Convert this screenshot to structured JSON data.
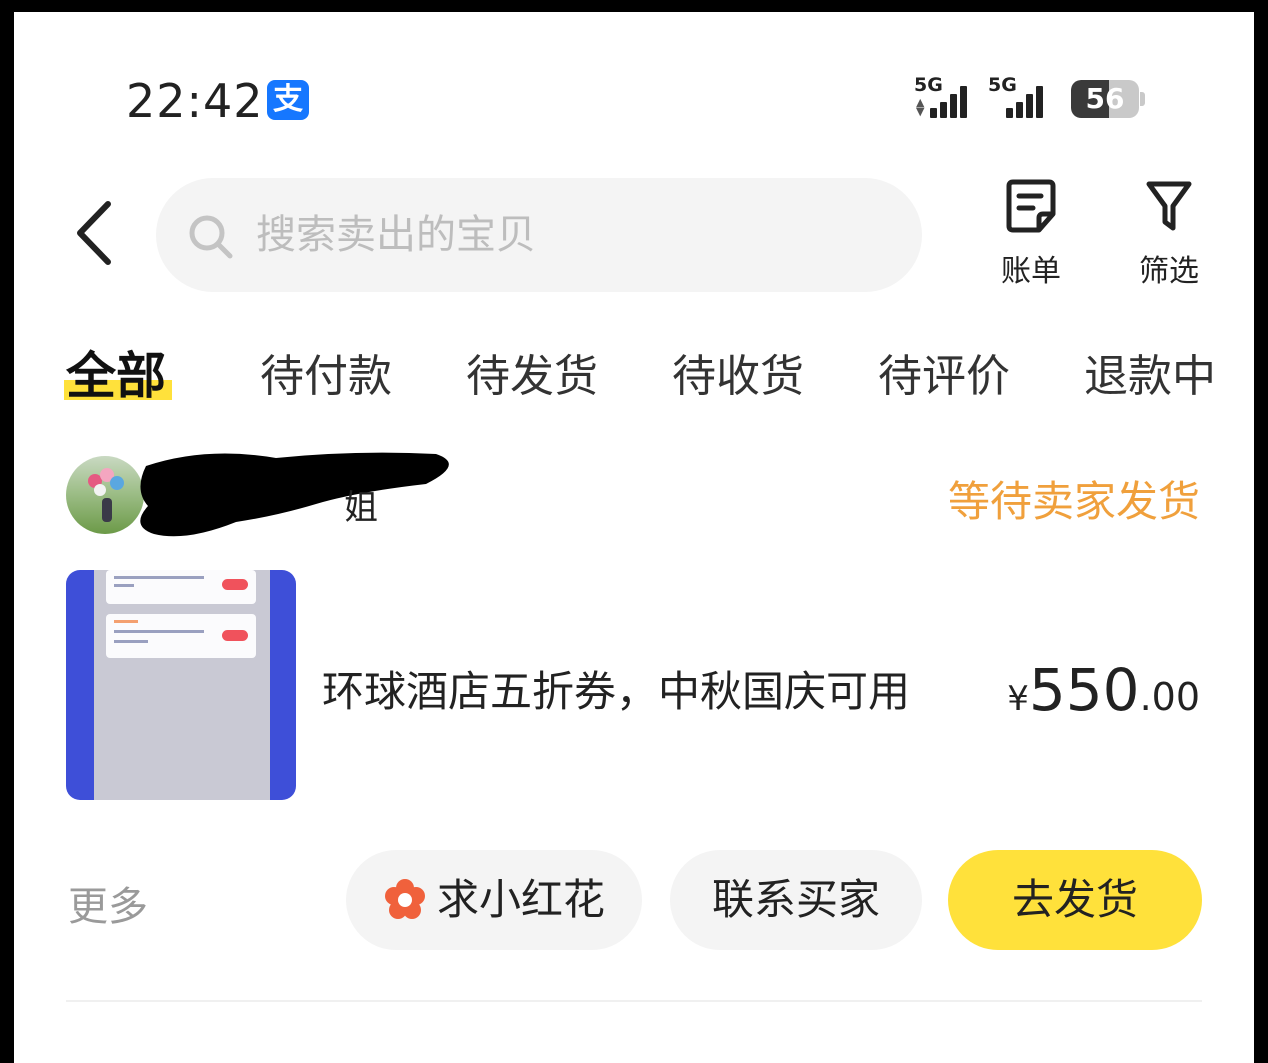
{
  "status_bar": {
    "time": "22:42",
    "app_badge": "支",
    "signal1_label": "5G",
    "signal2_label": "5G",
    "battery": "56",
    "battery_level": 0.56
  },
  "header": {
    "search_placeholder": "搜索卖出的宝贝",
    "bill_label": "账单",
    "filter_label": "筛选"
  },
  "tabs": [
    {
      "label": "全部",
      "active": true
    },
    {
      "label": "待付款"
    },
    {
      "label": "待发货"
    },
    {
      "label": "待收货"
    },
    {
      "label": "待评价"
    },
    {
      "label": "退款中"
    }
  ],
  "order": {
    "seller_name_visible": "姐",
    "status": "等待卖家发货",
    "item_title": "环球酒店五折券，中秋国庆可用",
    "price_currency": "¥",
    "price_int": "550",
    "price_dec": ".00",
    "more_label": "更多",
    "actions": {
      "flower": "求小红花",
      "contact": "联系买家",
      "ship": "去发货"
    }
  },
  "colors": {
    "accent_yellow": "#ffe13b",
    "status_orange": "#f0a03c",
    "alipay_blue": "#1677ff"
  }
}
